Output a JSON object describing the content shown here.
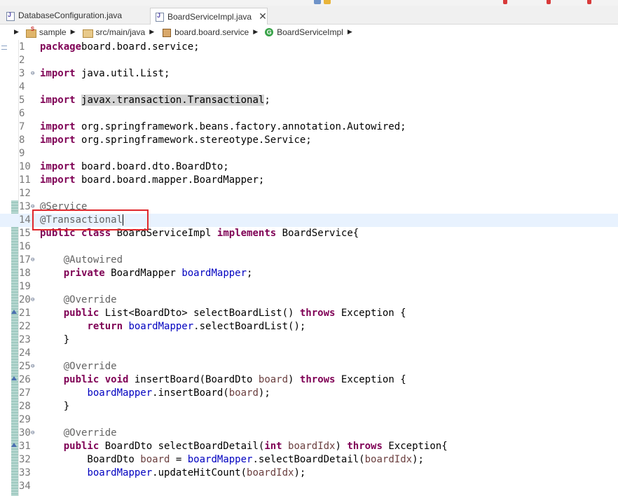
{
  "tabs": [
    {
      "label": "DatabaseConfiguration.java"
    },
    {
      "label": "BoardServiceImpl.java",
      "close": "✕"
    }
  ],
  "breadcrumb": [
    {
      "label": "sample"
    },
    {
      "label": "src/main/java"
    },
    {
      "label": "board.board.service"
    },
    {
      "label": "BoardServiceImpl"
    }
  ],
  "icons": {
    "class_badge": "G",
    "fold": "⊖",
    "crumb_arrow": "▶"
  },
  "colors": {
    "keyword": "#7f0055",
    "annotation": "#646464",
    "field": "#0000c0",
    "parameter": "#6a3e3e",
    "highlight_box": "#e0282c"
  },
  "code": {
    "cursor_line": 14,
    "lines": [
      {
        "n": "1",
        "fold": "",
        "tokens": [
          [
            "kw",
            "package"
          ],
          [
            "",
            "board.board.service;"
          ]
        ]
      },
      {
        "n": "2",
        "fold": "",
        "tokens": []
      },
      {
        "n": "3",
        "fold": "⊖",
        "tokens": [
          [
            "kw",
            "import"
          ],
          [
            "",
            " java.util.List;"
          ]
        ]
      },
      {
        "n": "4",
        "fold": "",
        "tokens": []
      },
      {
        "n": "5",
        "fold": "",
        "tokens": [
          [
            "kw",
            "import"
          ],
          [
            "",
            " "
          ],
          [
            "hl",
            "javax.transaction.Transactional"
          ],
          [
            "",
            ";"
          ]
        ]
      },
      {
        "n": "6",
        "fold": "",
        "tokens": []
      },
      {
        "n": "7",
        "fold": "",
        "tokens": [
          [
            "kw",
            "import"
          ],
          [
            "",
            " org.springframework.beans.factory.annotation.Autowired;"
          ]
        ]
      },
      {
        "n": "8",
        "fold": "",
        "tokens": [
          [
            "kw",
            "import"
          ],
          [
            "",
            " org.springframework.stereotype.Service;"
          ]
        ]
      },
      {
        "n": "9",
        "fold": "",
        "tokens": []
      },
      {
        "n": "10",
        "fold": "",
        "tokens": [
          [
            "kw",
            "import"
          ],
          [
            "",
            " board.board.dto.BoardDto;"
          ]
        ]
      },
      {
        "n": "11",
        "fold": "",
        "tokens": [
          [
            "kw",
            "import"
          ],
          [
            "",
            " board.board.mapper.BoardMapper;"
          ]
        ]
      },
      {
        "n": "12",
        "fold": "",
        "tokens": []
      },
      {
        "n": "13",
        "fold": "⊖",
        "tokens": [
          [
            "an",
            "@Service"
          ]
        ]
      },
      {
        "n": "14",
        "fold": "",
        "tokens": [
          [
            "an",
            "@Transactional"
          ]
        ]
      },
      {
        "n": "15",
        "fold": "",
        "tokens": [
          [
            "kw",
            "public"
          ],
          [
            "",
            " "
          ],
          [
            "kw",
            "class"
          ],
          [
            "",
            " BoardServiceImpl "
          ],
          [
            "kw",
            "implements"
          ],
          [
            "",
            " BoardService{"
          ]
        ]
      },
      {
        "n": "16",
        "fold": "",
        "tokens": []
      },
      {
        "n": "17",
        "fold": "⊖",
        "tokens": [
          [
            "",
            "    "
          ],
          [
            "an",
            "@Autowired"
          ]
        ]
      },
      {
        "n": "18",
        "fold": "",
        "tokens": [
          [
            "",
            "    "
          ],
          [
            "kw",
            "private"
          ],
          [
            "",
            " BoardMapper "
          ],
          [
            "fd",
            "boardMapper"
          ],
          [
            "",
            ";"
          ]
        ]
      },
      {
        "n": "19",
        "fold": "",
        "tokens": []
      },
      {
        "n": "20",
        "fold": "⊖",
        "tokens": [
          [
            "",
            "    "
          ],
          [
            "an",
            "@Override"
          ]
        ]
      },
      {
        "n": "21",
        "fold": "",
        "tokens": [
          [
            "",
            "    "
          ],
          [
            "kw",
            "public"
          ],
          [
            "",
            " List<BoardDto> selectBoardList() "
          ],
          [
            "kw",
            "throws"
          ],
          [
            "",
            " Exception {"
          ]
        ]
      },
      {
        "n": "22",
        "fold": "",
        "tokens": [
          [
            "",
            "        "
          ],
          [
            "kw",
            "return"
          ],
          [
            "",
            " "
          ],
          [
            "fd",
            "boardMapper"
          ],
          [
            "",
            ".selectBoardList();"
          ]
        ]
      },
      {
        "n": "23",
        "fold": "",
        "tokens": [
          [
            "",
            "    }"
          ]
        ]
      },
      {
        "n": "24",
        "fold": "",
        "tokens": []
      },
      {
        "n": "25",
        "fold": "⊖",
        "tokens": [
          [
            "",
            "    "
          ],
          [
            "an",
            "@Override"
          ]
        ]
      },
      {
        "n": "26",
        "fold": "",
        "tokens": [
          [
            "",
            "    "
          ],
          [
            "kw",
            "public"
          ],
          [
            "",
            " "
          ],
          [
            "kw",
            "void"
          ],
          [
            "",
            " insertBoard(BoardDto "
          ],
          [
            "pm",
            "board"
          ],
          [
            "",
            ") "
          ],
          [
            "kw",
            "throws"
          ],
          [
            "",
            " Exception {"
          ]
        ]
      },
      {
        "n": "27",
        "fold": "",
        "tokens": [
          [
            "",
            "        "
          ],
          [
            "fd",
            "boardMapper"
          ],
          [
            "",
            ".insertBoard("
          ],
          [
            "pm",
            "board"
          ],
          [
            "",
            ");"
          ]
        ]
      },
      {
        "n": "28",
        "fold": "",
        "tokens": [
          [
            "",
            "    }"
          ]
        ]
      },
      {
        "n": "29",
        "fold": "",
        "tokens": []
      },
      {
        "n": "30",
        "fold": "⊖",
        "tokens": [
          [
            "",
            "    "
          ],
          [
            "an",
            "@Override"
          ]
        ]
      },
      {
        "n": "31",
        "fold": "",
        "tokens": [
          [
            "",
            "    "
          ],
          [
            "kw",
            "public"
          ],
          [
            "",
            " BoardDto selectBoardDetail("
          ],
          [
            "kw",
            "int"
          ],
          [
            "",
            " "
          ],
          [
            "pm",
            "boardIdx"
          ],
          [
            "",
            ") "
          ],
          [
            "kw",
            "throws"
          ],
          [
            "",
            " Exception{"
          ]
        ]
      },
      {
        "n": "32",
        "fold": "",
        "tokens": [
          [
            "",
            "        BoardDto "
          ],
          [
            "pm",
            "board"
          ],
          [
            "",
            " = "
          ],
          [
            "fd",
            "boardMapper"
          ],
          [
            "",
            ".selectBoardDetail("
          ],
          [
            "pm",
            "boardIdx"
          ],
          [
            "",
            ");"
          ]
        ]
      },
      {
        "n": "33",
        "fold": "",
        "tokens": [
          [
            "",
            "        "
          ],
          [
            "fd",
            "boardMapper"
          ],
          [
            "",
            ".updateHitCount("
          ],
          [
            "pm",
            "boardIdx"
          ],
          [
            "",
            ");"
          ]
        ]
      },
      {
        "n": "34",
        "fold": "",
        "tokens": []
      }
    ]
  }
}
